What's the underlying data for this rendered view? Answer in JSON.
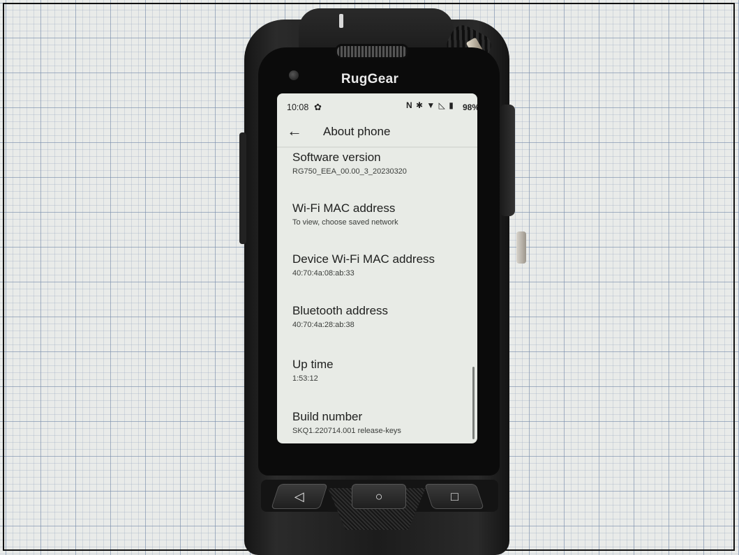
{
  "device": {
    "brand": "RugGear"
  },
  "status_bar": {
    "time": "10:08",
    "icons": [
      "settings-gear-icon",
      "nfc-icon",
      "bluetooth-icon",
      "wifi-icon",
      "no-signal-icon",
      "battery-icon"
    ],
    "nfc_label": "N",
    "battery": "98%"
  },
  "app_bar": {
    "back_icon": "arrow-left-icon",
    "title": "About phone"
  },
  "items": [
    {
      "title": "Software version",
      "subtitle": "RG750_EEA_00.00_3_20230320"
    },
    {
      "title": "Wi-Fi MAC address",
      "subtitle": "To view, choose saved network"
    },
    {
      "title": "Device Wi-Fi MAC address",
      "subtitle": "40:70:4a:08:ab:33"
    },
    {
      "title": "Bluetooth address",
      "subtitle": "40:70:4a:28:ab:38"
    },
    {
      "title": "Up time",
      "subtitle": "1:53:12"
    },
    {
      "title": "Build number",
      "subtitle": "SKQ1.220714.001 release-keys"
    }
  ],
  "nav_buttons": {
    "back_icon": "triangle-back-icon",
    "home_icon": "circle-home-icon",
    "recent_icon": "square-recents-icon"
  },
  "colors": {
    "screen_bg": "#e8ebe6",
    "text_primary": "#1e1f1e",
    "body": "#1c1c1c"
  }
}
